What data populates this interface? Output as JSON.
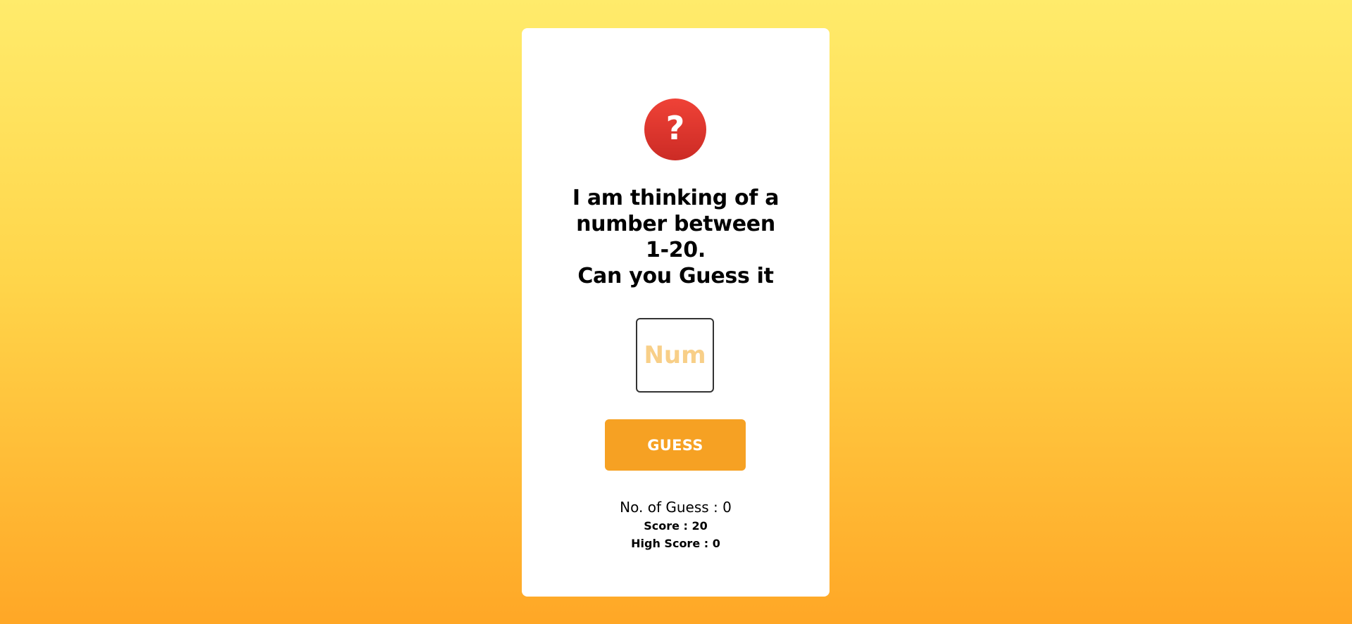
{
  "badge": {
    "icon": "question-mark-icon",
    "glyph": "?",
    "color": "#e0352e"
  },
  "prompt": {
    "lines": [
      "I am thinking of a",
      "number between",
      "1-20.",
      "Can you Guess it"
    ]
  },
  "input": {
    "placeholder": "Num",
    "value": ""
  },
  "button": {
    "label": "GUESS",
    "color": "#f6a123"
  },
  "stats": {
    "guess_count": "No. of Guess : 0",
    "score": "Score : 20",
    "high_score": "High Score : 0"
  }
}
